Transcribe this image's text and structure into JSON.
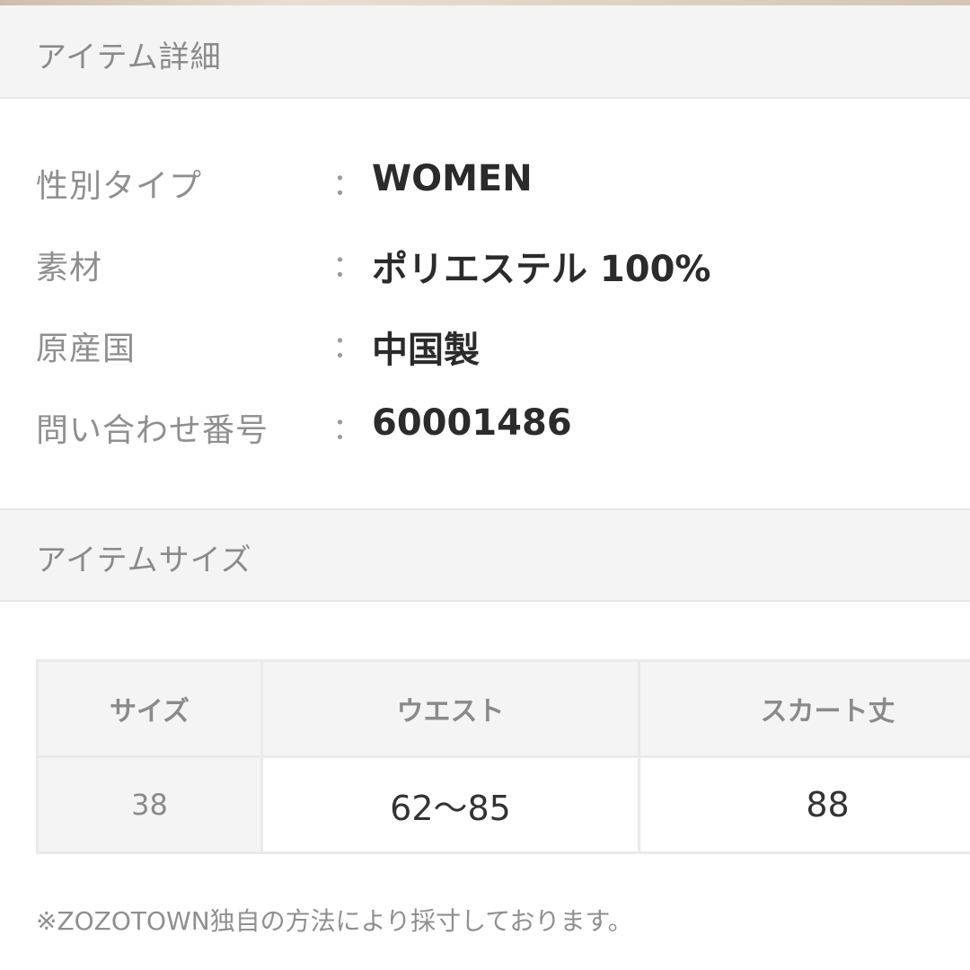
{
  "item_detail": {
    "header": "アイテム詳細",
    "separator": "：",
    "rows": [
      {
        "label": "性別タイプ",
        "value": "WOMEN"
      },
      {
        "label": "素材",
        "value": "ポリエステル 100%"
      },
      {
        "label": "原産国",
        "value": "中国製"
      },
      {
        "label": "問い合わせ番号",
        "value": "60001486"
      }
    ]
  },
  "item_size": {
    "header": "アイテムサイズ",
    "columns": [
      "サイズ",
      "ウエスト",
      "スカート丈"
    ],
    "rows": [
      [
        "38",
        "62〜85",
        "88"
      ]
    ],
    "note": "※ZOZOTOWN独自の方法により採寸しております。"
  }
}
